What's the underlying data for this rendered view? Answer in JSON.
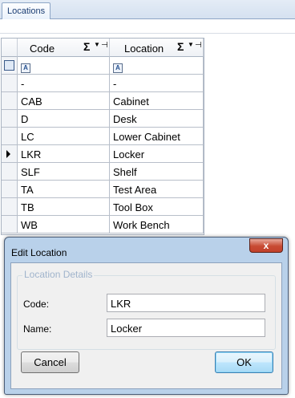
{
  "tab": {
    "label": "Locations"
  },
  "grid": {
    "columns": [
      "Code",
      "Location"
    ],
    "sum_symbol": "Σ",
    "filter_glyph": "A",
    "rows": [
      {
        "code": "-",
        "location": "-"
      },
      {
        "code": "CAB",
        "location": "Cabinet"
      },
      {
        "code": "D",
        "location": "Desk"
      },
      {
        "code": "LC",
        "location": "Lower Cabinet"
      },
      {
        "code": "LKR",
        "location": "Locker",
        "current": true
      },
      {
        "code": "SLF",
        "location": "Shelf"
      },
      {
        "code": "TA",
        "location": "Test Area"
      },
      {
        "code": "TB",
        "location": "Tool Box"
      },
      {
        "code": "WB",
        "location": "Work Bench"
      }
    ]
  },
  "dialog": {
    "title": "Edit Location",
    "close_glyph": "x",
    "group_title": "Location Details",
    "code_label": "Code:",
    "code_value": "LKR",
    "name_label": "Name:",
    "name_value": "Locker",
    "cancel_label": "Cancel",
    "ok_label": "OK"
  },
  "colors": {
    "dialog_frame": "#b9d1ea",
    "close_button": "#c84a33",
    "tab_text": "#1a3d73"
  }
}
